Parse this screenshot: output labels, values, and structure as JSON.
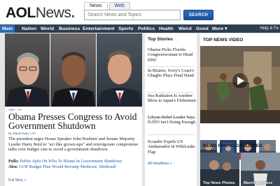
{
  "brand": {
    "primary": "AOL",
    "secondary": "News",
    "dot": "."
  },
  "search": {
    "tabs": [
      "News",
      "Web"
    ],
    "placeholder": "Search News and Topics",
    "button_label": "SEARCH"
  },
  "nav": {
    "items": [
      "Main",
      "Nation",
      "World",
      "Business",
      "Entertainment",
      "Sports",
      "Politics",
      "Health",
      "Weird",
      "Good",
      "More ▾"
    ],
    "help": "Help & Fe"
  },
  "main_story": {
    "photo_credit": "CBS - AP",
    "headline": "Obama Presses Congress to Avoid Government Shutdown",
    "byline_prefix": "By",
    "byline_author": "David Espo",
    "byline_source": "| AP",
    "summary": "The president urges House Speaker John Boehner and Senate Majority Leader Harry Reid to \"act like grown-ups\" and reinvigorate compromise talks over budget cuts to avoid a government shutdown.",
    "polls_label": "Polls:",
    "polls_link": "Public Split On Who To Blame In Government Shutdown",
    "also_label": "Also:",
    "also_link": "GOP Budget Plan Would Revamp Medicare, Medicaid",
    "full_story": "Full Story »"
  },
  "top_stories": {
    "title": "Top Stories",
    "items": [
      "Obama Picks Florida Congresswoman to Head DNC",
      "In Bizarre, Ivory's Coast's Gbagbo Plays Final Hand",
      "Sea Radiation Is Another Blow to Japan's Fishermen",
      "Libyan Rebel Leader Says NATO Isn't Doing Enough",
      "Ecuador Expels US Ambassador in WikiLeaks Flap"
    ],
    "all_headlines": "All Headlines »"
  },
  "video": {
    "title": "TOP NEWS VIDEO"
  },
  "gallery": {
    "title": "NEWS PHOTO GALLERIES",
    "items": [
      "Top News Photos",
      "March Madness"
    ]
  }
}
